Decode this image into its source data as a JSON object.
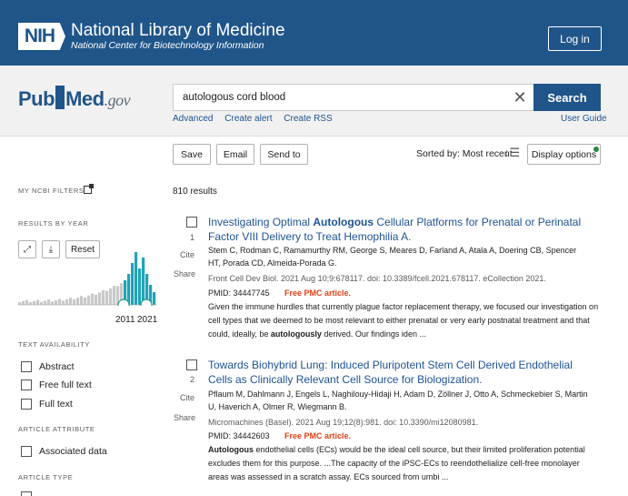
{
  "header": {
    "nih_short": "NIH",
    "nih_title": "National Library of Medicine",
    "nih_subtitle": "National Center for Biotechnology Information",
    "login_label": "Log in"
  },
  "search": {
    "logo_pub": "Pub",
    "logo_med": "Med",
    "logo_gov": ".gov",
    "query": "autologous cord blood",
    "button_label": "Search",
    "links": [
      "Advanced",
      "Create alert",
      "Create RSS"
    ],
    "user_guide": "User Guide"
  },
  "toolbar": {
    "save": "Save",
    "email": "Email",
    "send_to": "Send to",
    "sorted_by": "Sorted by: Most recent",
    "display_options": "Display options"
  },
  "sidebar": {
    "my_filters": "MY NCBI FILTERS",
    "results_by_year": "RESULTS BY YEAR",
    "reset": "Reset",
    "year_start": "2011",
    "year_end": "2021",
    "text_availability": "TEXT AVAILABILITY",
    "text_filters": [
      "Abstract",
      "Free full text",
      "Full text"
    ],
    "article_attribute": "ARTICLE ATTRIBUTE",
    "attribute_filters": [
      "Associated data"
    ],
    "article_type": "ARTICLE TYPE"
  },
  "results": {
    "count": "810 results",
    "items": [
      {
        "num": "1",
        "cite": "Cite",
        "share": "Share",
        "title_pre": "Investigating Optimal ",
        "title_bold": "Autologous",
        "title_post": " Cellular Platforms for Prenatal or Perinatal Factor VIII Delivery to Treat Hemophilia A.",
        "authors": "Stem C, Rodman C, Ramamurthy RM, George S, Meares D, Farland A, Atala A, Doering CB, Spencer HT, Porada CD, Almeida-Porada G.",
        "journal": "Front Cell Dev Biol. 2021 Aug 10;9:678117. doi: 10.3389/fcell.2021.678117. eCollection 2021.",
        "pmid": "PMID: 34447745",
        "pmc": "Free PMC article.",
        "snippet_pre": "Given the immune hurdles that currently plague factor replacement therapy, we focused our investigation on cell types that we deemed to be most relevant to either prenatal or very early postnatal treatment and that could, ideally, be ",
        "snippet_bold": "autologously",
        "snippet_post": " derived. Our findings iden ..."
      },
      {
        "num": "2",
        "cite": "Cite",
        "share": "Share",
        "title_pre": "Towards Biohybrid Lung: Induced Pluripotent Stem Cell Derived Endothelial Cells as Clinically Relevant Cell Source for Biologization.",
        "title_bold": "",
        "title_post": "",
        "authors": "Pflaum M, Dahlmann J, Engels L, Naghilouy-Hidaji H, Adam D, Zöllner J, Otto A, Schmeckebier S, Martin U, Haverich A, Olmer R, Wiegmann B.",
        "journal": "Micromachines (Basel). 2021 Aug 19;12(8):981. doi: 10.3390/mi12080981.",
        "pmid": "PMID: 34442603",
        "pmc": "Free PMC article.",
        "snippet_pre": "",
        "snippet_bold": "Autologous",
        "snippet_post": " endothelial cells (ECs) would be the ideal cell source, but their limited proliferation potential excludes them for this purpose. ...The capacity of the iPSC-ECs to reendothelialize cell-free monolayer areas was assessed in a scratch assay. ECs sourced from umbi ..."
      }
    ]
  }
}
